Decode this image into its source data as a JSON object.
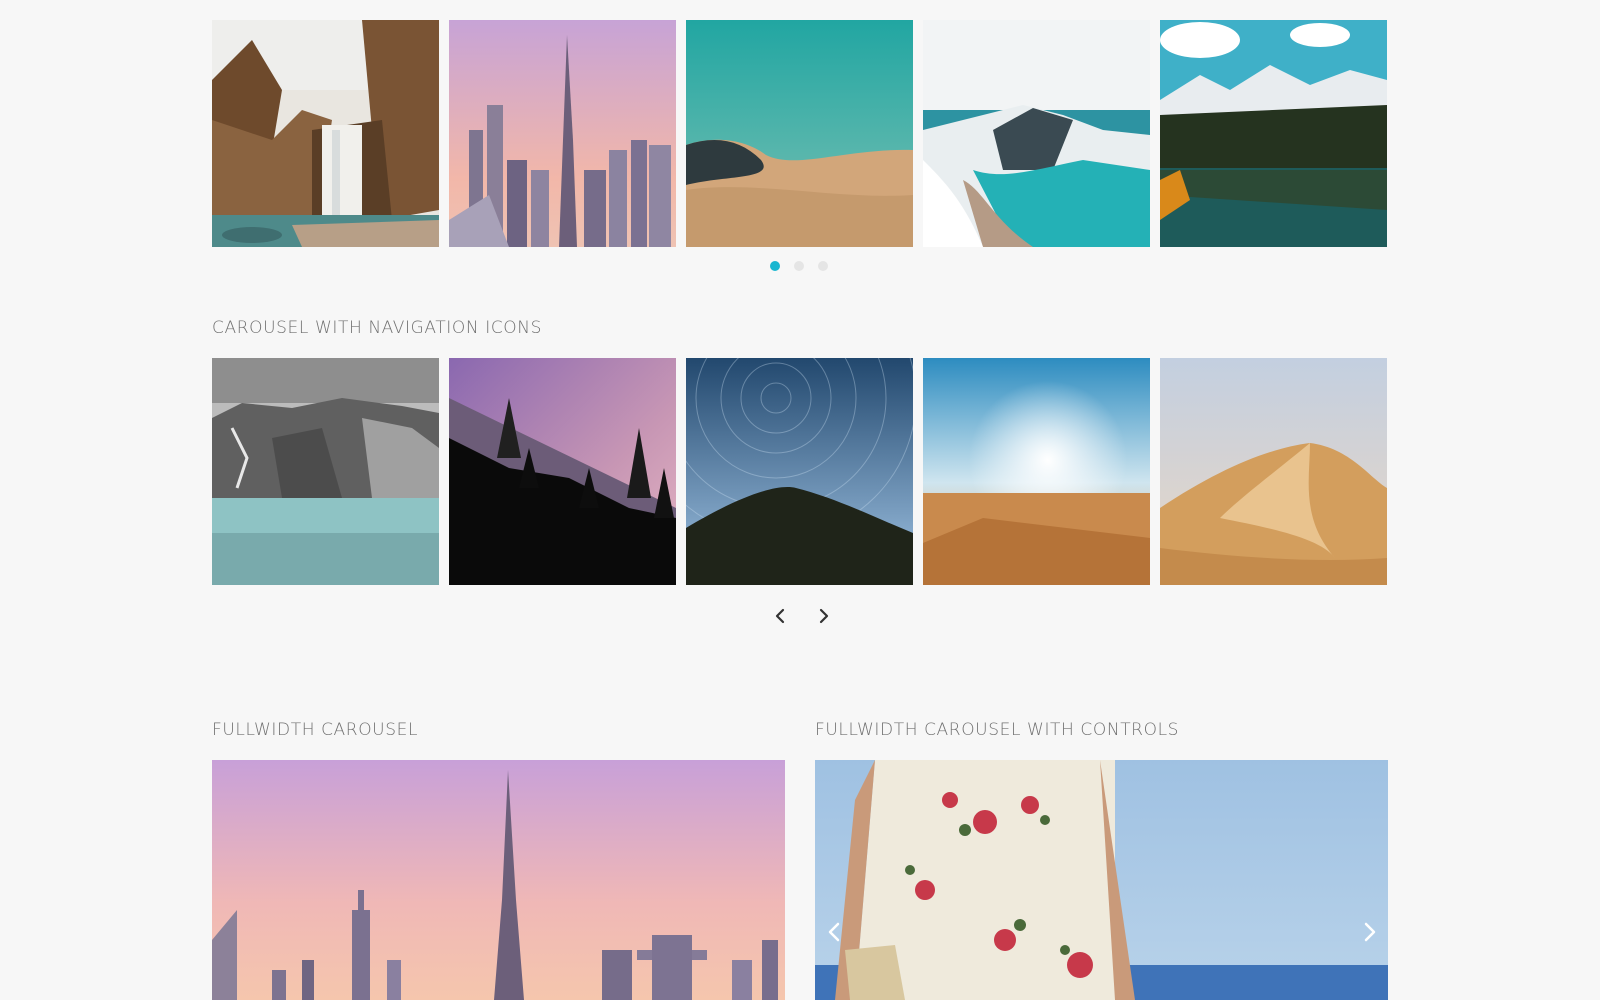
{
  "carousel_dots": {
    "images": [
      {
        "name": "waterfall-image",
        "subject": "Waterfall in autumn forest"
      },
      {
        "name": "city-skyline-image",
        "subject": "City skyline at pink dusk"
      },
      {
        "name": "desert-dune-teal-image",
        "subject": "Desert dune under teal sky"
      },
      {
        "name": "coast-arch-image",
        "subject": "Snowy coast with rock arch"
      },
      {
        "name": "mountain-lake-image",
        "subject": "Mountain lake with pine forest"
      }
    ],
    "dots": 3,
    "active_dot": 0,
    "accent_color": "#19b6d0"
  },
  "carousel_nav": {
    "title": "CAROUSEL WITH NAVIGATION ICONS",
    "images": [
      {
        "name": "rocky-cliffs-sea-image"
      },
      {
        "name": "forest-silhouette-image"
      },
      {
        "name": "star-trails-image"
      },
      {
        "name": "desert-sunrise-image"
      },
      {
        "name": "sand-dune-image"
      }
    ],
    "prev_icon": "chevron-left-icon",
    "next_icon": "chevron-right-icon"
  },
  "fullwidth": {
    "title": "FULLWIDTH CAROUSEL"
  },
  "fullwidth_controls": {
    "title": "FULLWIDTH CAROUSEL WITH CONTROLS",
    "prev_icon": "chevron-left-icon",
    "next_icon": "chevron-right-icon"
  }
}
